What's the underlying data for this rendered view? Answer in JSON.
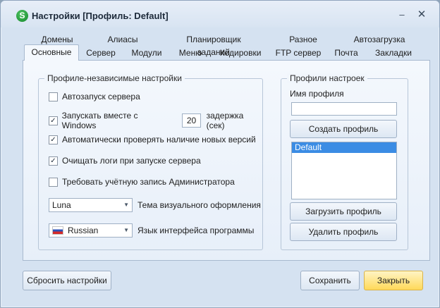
{
  "window": {
    "title": "Настройки [Профиль: Default]",
    "app_icon_letter": "S",
    "minimize_glyph": "–",
    "close_glyph": "✕"
  },
  "tabs": {
    "row1": [
      "Домены",
      "Алиасы",
      "Планировщик заданий",
      "Разное",
      "Автозагрузка"
    ],
    "row2": [
      "Основные",
      "Сервер",
      "Модули",
      "Меню",
      "Кодировки",
      "FTP сервер",
      "Почта",
      "Закладки"
    ],
    "active": "Основные"
  },
  "profile_independent": {
    "title": "Профиле-независимые настройки",
    "options": [
      {
        "label": "Автозапуск сервера",
        "checked": false
      },
      {
        "label": "Запускать вместе с Windows",
        "checked": true
      },
      {
        "label": "Автоматически проверять наличие новых версий",
        "checked": true
      },
      {
        "label": "Очищать логи при запуске сервера",
        "checked": true
      },
      {
        "label": "Требовать учётную запись Администратора",
        "checked": false
      }
    ],
    "delay_value": "20",
    "delay_label": "задержка (сек)",
    "theme_value": "Luna",
    "theme_label": "Тема визуального оформления",
    "language_value": "Russian",
    "language_label": "Язык интерфейса программы"
  },
  "profiles": {
    "title": "Профили настроек",
    "name_label": "Имя профиля",
    "name_value": "",
    "create_button": "Создать профиль",
    "list": [
      "Default"
    ],
    "load_button": "Загрузить профиль",
    "delete_button": "Удалить профиль"
  },
  "footer": {
    "reset_button": "Сбросить настройки",
    "save_button": "Сохранить",
    "close_button": "Закрыть"
  },
  "colors": {
    "accent_selection": "#3b8ce4",
    "primary_button": "#ffd95a",
    "window_bg": "#d5e2f1"
  }
}
